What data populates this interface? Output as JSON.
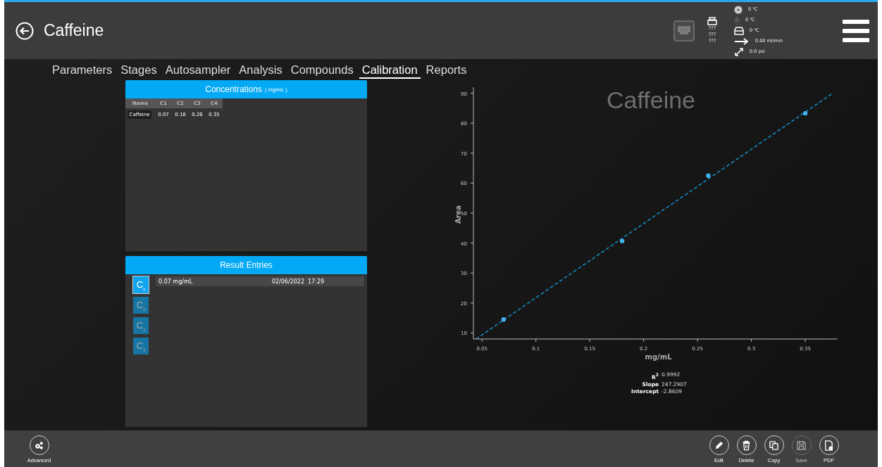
{
  "header": {
    "title": "Caffeine",
    "printer_lines": [
      "???",
      "???",
      "???"
    ],
    "status": [
      {
        "kind": "disc",
        "text": "0 ℃"
      },
      {
        "kind": "drop",
        "text": "0 ℃"
      },
      {
        "kind": "tray",
        "text": "0 ℃"
      },
      {
        "kind": "flow",
        "text": "0.00 ml/min"
      },
      {
        "kind": "pressure",
        "text": "0.0 psi"
      }
    ]
  },
  "tabs": [
    {
      "label": "Parameters",
      "selected": false
    },
    {
      "label": "Stages",
      "selected": false
    },
    {
      "label": "Autosampler",
      "selected": false
    },
    {
      "label": "Analysis",
      "selected": false
    },
    {
      "label": "Compounds",
      "selected": false
    },
    {
      "label": "Calibration",
      "selected": true
    },
    {
      "label": "Reports",
      "selected": false
    }
  ],
  "concentrations": {
    "title": "Concentrations",
    "unit": "( mg/mL )",
    "columns": [
      "Name",
      "C1",
      "C2",
      "C3",
      "C4"
    ],
    "rows": [
      [
        "Caffeine",
        "0.07",
        "0.18",
        "0.26",
        "0.35"
      ]
    ]
  },
  "results": {
    "title": "Result Entries",
    "levels": [
      {
        "label": "C$_{1}$",
        "selected": true
      },
      {
        "label": "C$_{2}$",
        "selected": false
      },
      {
        "label": "C$_{3}$",
        "selected": false
      },
      {
        "label": "C$_{4}$",
        "selected": false
      }
    ],
    "entries": [
      {
        "amount": "0.07 mg/mL",
        "date": "02/06/2022",
        "time": "17:29"
      }
    ]
  },
  "chart": {
    "chart_data": {
      "type": "scatter",
      "title": "Caffeine",
      "xlabel": "mg/mL",
      "ylabel": "Area",
      "x": [
        0.07,
        0.18,
        0.26,
        0.35
      ],
      "series": [
        {
          "color": "#3fb4ee",
          "values": [
            14.5,
            40.7,
            62.5,
            83.3
          ]
        }
      ],
      "xlim": [
        0.042,
        0.38
      ],
      "ylim": [
        8,
        92
      ],
      "xticks": [
        0.05,
        0.1,
        0.15,
        0.2,
        0.25,
        0.3,
        0.35
      ],
      "yticks": [
        10,
        20,
        30,
        40,
        50,
        60,
        70,
        80,
        90
      ]
    },
    "stats": [
      {
        "label": "R$^{2}$",
        "value": "0.9992"
      },
      {
        "label": "Slope",
        "value": "247.2907"
      },
      {
        "label": "Intercept",
        "value": "-2.8609"
      }
    ]
  },
  "footer": {
    "left": [
      {
        "kind": "advanced",
        "label": "Advanced",
        "disabled": false
      }
    ],
    "right": [
      {
        "kind": "edit",
        "label": "Edit",
        "disabled": false
      },
      {
        "kind": "delete",
        "label": "Delete",
        "disabled": false
      },
      {
        "kind": "copy",
        "label": "Copy",
        "disabled": false
      },
      {
        "kind": "save",
        "label": "Save",
        "disabled": true
      },
      {
        "kind": "pdf",
        "label": "PDF",
        "disabled": false
      }
    ]
  }
}
